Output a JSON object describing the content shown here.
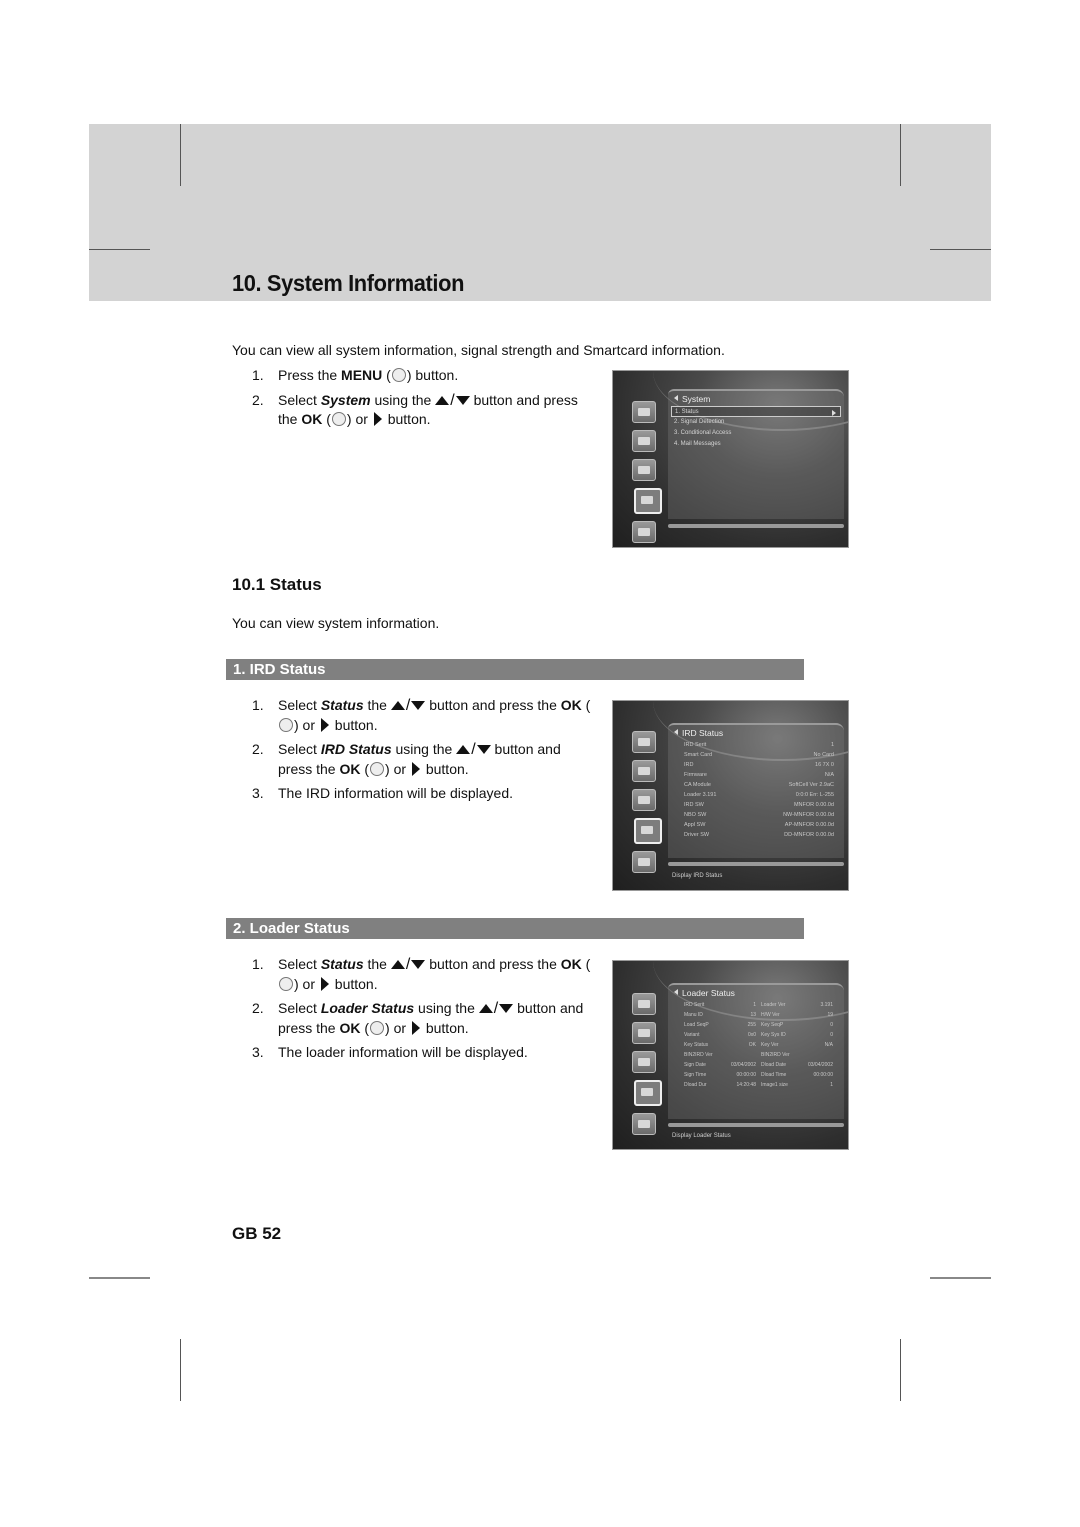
{
  "page": {
    "title": "10. System Information",
    "intro": "You can view all system information, signal strength and Smartcard information.",
    "page_number": "GB 52"
  },
  "intro_steps": {
    "s1_num": "1.",
    "s1_a": "Press the ",
    "s1_key": "MENU",
    "s1_b": " button.",
    "s2_num": "2.",
    "s2_a": "Select ",
    "s2_item": "System",
    "s2_b": " using the ",
    "s2_c": " button and press the ",
    "s2_key": "OK",
    "s2_d": " or ",
    "s2_e": " button."
  },
  "icons": {
    "menu_button_label": "MENU",
    "ok_button_label": "OK"
  },
  "status_section": {
    "title": "10.1 Status",
    "description": "You can view system information."
  },
  "ird": {
    "heading": "1. IRD Status",
    "steps": {
      "s1_num": "1.",
      "s1_a": "Select ",
      "s1_item": "Status",
      "s1_b": " the ",
      "s1_c": " button and press the ",
      "s1_key": "OK",
      "s1_d": " or ",
      "s1_e": " button.",
      "s2_num": "2.",
      "s2_a": "Select ",
      "s2_item": "IRD Status",
      "s2_b": " using the ",
      "s2_c": " button and press the ",
      "s2_key": "OK",
      "s2_d": " or ",
      "s2_e": " button.",
      "s3_num": "3.",
      "s3_text": "The IRD information will be displayed."
    }
  },
  "loader": {
    "heading": "2. Loader Status",
    "steps": {
      "s1_num": "1.",
      "s1_a": "Select ",
      "s1_item": "Status",
      "s1_b": " the ",
      "s1_c": " button and press the ",
      "s1_key": "OK",
      "s1_d": " or ",
      "s1_e": " button.",
      "s2_num": "2.",
      "s2_a": "Select ",
      "s2_item": "Loader Status",
      "s2_b": " using the ",
      "s2_c": " button and press the ",
      "s2_key": "OK",
      "s2_d": " or ",
      "s2_e": " button.",
      "s3_num": "3.",
      "s3_text": "The loader information will be displayed."
    }
  },
  "screens": {
    "system_menu": {
      "title": "System",
      "items": [
        "1. Status",
        "2. Signal Detection",
        "3. Conditional Access",
        "4. Mail Messages"
      ],
      "selected_index": 0
    },
    "ird_status": {
      "title": "IRD Status",
      "rows": [
        {
          "label": "IRD Serit",
          "value": "1"
        },
        {
          "label": "Smart Card",
          "value": "No Card"
        },
        {
          "label": "IRD",
          "value": "16 7X 0"
        },
        {
          "label": "Firmware",
          "value": "N/A"
        },
        {
          "label": "CA Module",
          "value": "SoftCell Ver 2.9aC"
        },
        {
          "label": "Loader 3.191",
          "value": "0:0:0 Err: L-255"
        },
        {
          "label": "IRD SW",
          "value": "MNFOR 0.00.0d"
        },
        {
          "label": "NBO SW",
          "value": "NW-MNFOR 0.00.0d"
        },
        {
          "label": "Appl SW",
          "value": "AP-MNFOR 0.00.0d"
        },
        {
          "label": "Driver SW",
          "value": "DD-MNFOR 0.00.0d"
        }
      ],
      "footer": "Display IRD Status"
    },
    "loader_status": {
      "title": "Loader Status",
      "rows": [
        {
          "l1": "IRD Serit",
          "v1": "1",
          "l2": "Loader Ver",
          "v2": "3.191"
        },
        {
          "l1": "Manu ID",
          "v1": "13",
          "l2": "H/W Ver",
          "v2": "19"
        },
        {
          "l1": "Load SeqP",
          "v1": "255",
          "l2": "Key SeqP",
          "v2": "0"
        },
        {
          "l1": "Variant",
          "v1": "0x0",
          "l2": "Key Sys ID",
          "v2": "0"
        },
        {
          "l1": "Key Status",
          "v1": "OK",
          "l2": "Key Ver",
          "v2": "N/A"
        },
        {
          "l1": "BIN2IRD Ver",
          "v1": "",
          "l2": "BIN2IRD Ver",
          "v2": ""
        },
        {
          "l1": "Sign Date",
          "v1": "03/04/2002",
          "l2": "Dload Date",
          "v2": "03/04/2002"
        },
        {
          "l1": "Sign Time",
          "v1": "00:00:00",
          "l2": "Dload Time",
          "v2": "00:00:00"
        },
        {
          "l1": "Dload Dur",
          "v1": "14:20:48",
          "l2": "Image1 size",
          "v2": "1"
        }
      ],
      "footer": "Display Loader Status"
    }
  }
}
